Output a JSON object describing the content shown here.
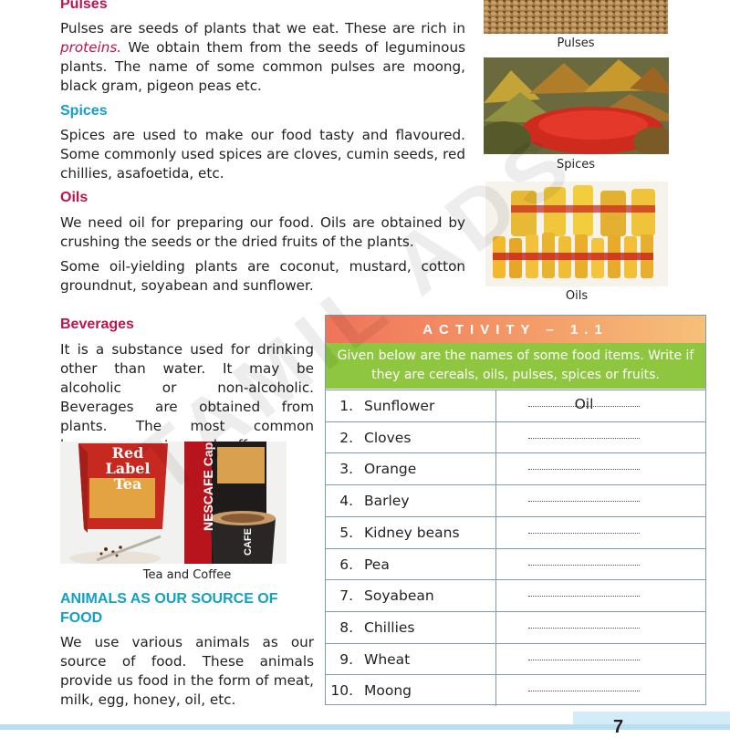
{
  "pulses": {
    "heading": "Pulses",
    "text_before": "Pulses are seeds of plants that we eat. These are rich in ",
    "text_em": "proteins.",
    "text_after": " We obtain them from the seeds of leguminous plants. The name of some common pulses are moong, black gram, pigeon peas etc.",
    "caption": "Pulses"
  },
  "spices": {
    "heading": "Spices",
    "text": "Spices are used to make our food tasty and flavoured. Some commonly used spices are cloves, cumin seeds, red chillies, asafoetida, etc.",
    "caption": "Spices"
  },
  "oils": {
    "heading": "Oils",
    "text1": "We need oil for preparing our food. Oils are obtained by crushing the seeds or the dried fruits of the plants.",
    "text2": "Some oil-yielding plants are coconut, mustard, cotton groundnut, soyabean and sunflower.",
    "caption": "Oils"
  },
  "beverages": {
    "heading": "Beverages",
    "text": "It is a substance used for drinking other than water. It may be alcoholic or non-alcoholic. Beverages are obtained from plants. The most common beverages are tea and coffee.",
    "caption": "Tea and Coffee",
    "tea_box_label": "Red Label Tea",
    "coffee_box_label": "NESCAFE Cappuccino",
    "mug_label": "CAFE"
  },
  "animals": {
    "heading": "ANIMALS AS OUR SOURCE OF FOOD",
    "text": "We use various animals as our source of food. These animals provide us food in the form of meat, milk, egg, honey, oil, etc."
  },
  "activity": {
    "title": "ACTIVITY – 1.1",
    "instruction": "Given below are the names of some food items. Write if they are cereals, oils, pulses, spices or fruits.",
    "rows": [
      {
        "num": "1.",
        "item": "Sunflower",
        "answer": "Oil"
      },
      {
        "num": "2.",
        "item": "Cloves",
        "answer": ""
      },
      {
        "num": "3.",
        "item": "Orange",
        "answer": ""
      },
      {
        "num": "4.",
        "item": "Barley",
        "answer": ""
      },
      {
        "num": "5.",
        "item": "Kidney beans",
        "answer": ""
      },
      {
        "num": "6.",
        "item": "Pea",
        "answer": ""
      },
      {
        "num": "7.",
        "item": "Soyabean",
        "answer": ""
      },
      {
        "num": "8.",
        "item": "Chillies",
        "answer": ""
      },
      {
        "num": "9.",
        "item": "Wheat",
        "answer": ""
      },
      {
        "num": "10.",
        "item": "Moong",
        "answer": ""
      }
    ]
  },
  "watermark": "TAMIL ADS",
  "page_number": "7"
}
